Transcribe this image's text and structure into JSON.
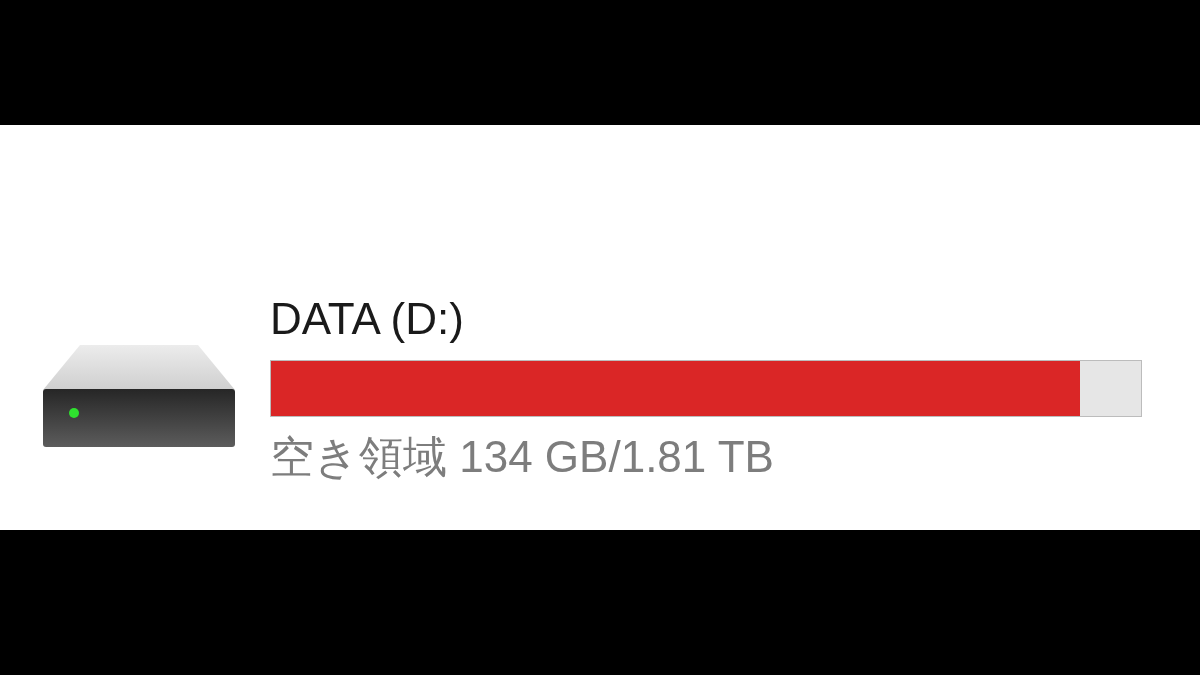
{
  "drive": {
    "name": "DATA (D:)",
    "level": 0.93,
    "free_space": "空き領域 134 GB/1.81 TB"
  }
}
